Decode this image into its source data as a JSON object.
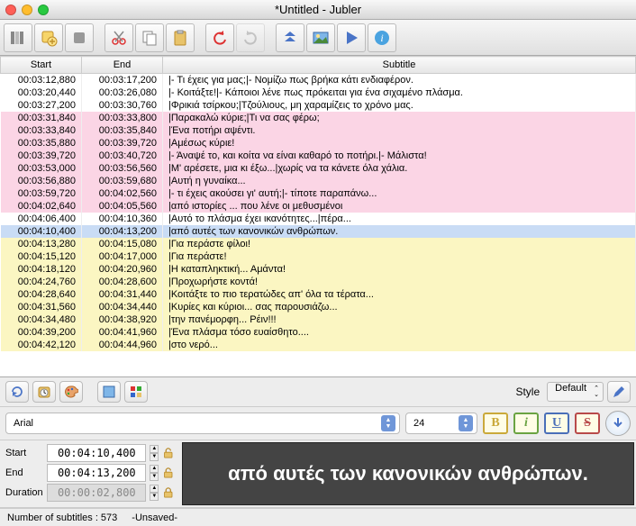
{
  "window": {
    "title": "*Untitled - Jubler"
  },
  "columns": {
    "start": "Start",
    "end": "End",
    "subtitle": "Subtitle"
  },
  "rows": [
    {
      "c": "white",
      "s": "00:03:12,880",
      "e": "00:03:17,200",
      "t": "|- Τι έχεις για μας;|- Νομίζω πως βρήκα κάτι ενδιαφέρον."
    },
    {
      "c": "white",
      "s": "00:03:20,440",
      "e": "00:03:26,080",
      "t": "|- Κοιτάξτε!|- Κάποιοι λένε πως πρόκειται για ένα σιχαμένο πλάσμα."
    },
    {
      "c": "white",
      "s": "00:03:27,200",
      "e": "00:03:30,760",
      "t": "|Φρικιά τσίρκου;|Τζούλιους, μη χαραμίζεις το χρόνο μας."
    },
    {
      "c": "pink",
      "s": "00:03:31,840",
      "e": "00:03:33,800",
      "t": "|Παρακαλώ κύριε;|Τι να σας φέρω;"
    },
    {
      "c": "pink",
      "s": "00:03:33,840",
      "e": "00:03:35,840",
      "t": "|Ένα ποτήρι αψέντι."
    },
    {
      "c": "pink",
      "s": "00:03:35,880",
      "e": "00:03:39,720",
      "t": "|Αμέσως κύριε!"
    },
    {
      "c": "pink",
      "s": "00:03:39,720",
      "e": "00:03:40,720",
      "t": "|- Άναψέ το, και κοίτα να είναι καθαρό το ποτήρι.|- Μάλιστα!"
    },
    {
      "c": "pink",
      "s": "00:03:53,000",
      "e": "00:03:56,560",
      "t": "|Μ' αρέσετε, μια κι έξω...|χωρίς να τα κάνετε όλα χάλια."
    },
    {
      "c": "pink",
      "s": "00:03:56,880",
      "e": "00:03:59,680",
      "t": "|Αυτή η γυναίκα..."
    },
    {
      "c": "pink",
      "s": "00:03:59,720",
      "e": "00:04:02,560",
      "t": "|- τι έχεις ακούσει γι' αυτή;|- τίποτε παραπάνω..."
    },
    {
      "c": "pink",
      "s": "00:04:02,640",
      "e": "00:04:05,560",
      "t": "|από ιστορίες ... που λένε οι μεθυσμένοι"
    },
    {
      "c": "white",
      "s": "00:04:06,400",
      "e": "00:04:10,360",
      "t": "|Αυτό το πλάσμα έχει ικανότητες...|πέρα..."
    },
    {
      "c": "blue",
      "s": "00:04:10,400",
      "e": "00:04:13,200",
      "t": "|από αυτές των κανονικών ανθρώπων."
    },
    {
      "c": "yellow",
      "s": "00:04:13,280",
      "e": "00:04:15,080",
      "t": "|Για περάστε φίλοι!"
    },
    {
      "c": "yellow",
      "s": "00:04:15,120",
      "e": "00:04:17,000",
      "t": "|Για περάστε!"
    },
    {
      "c": "yellow",
      "s": "00:04:18,120",
      "e": "00:04:20,960",
      "t": "|Η καταπληκτική... Αμάντα!"
    },
    {
      "c": "yellow",
      "s": "00:04:24,760",
      "e": "00:04:28,600",
      "t": "|Προχωρήστε κοντά!"
    },
    {
      "c": "yellow",
      "s": "00:04:28,640",
      "e": "00:04:31,440",
      "t": "|Κοιτάξτε το πιο τερατώδες απ' όλα τα τέρατα..."
    },
    {
      "c": "yellow",
      "s": "00:04:31,560",
      "e": "00:04:34,440",
      "t": "|Κυρίες και κύριοι... σας παρουσιάζω..."
    },
    {
      "c": "yellow",
      "s": "00:04:34,480",
      "e": "00:04:38,920",
      "t": "|την πανέμορφη... Ρέιν!!!"
    },
    {
      "c": "yellow",
      "s": "00:04:39,200",
      "e": "00:04:41,960",
      "t": "|Ένα πλάσμα τόσο ευαίσθητο...."
    },
    {
      "c": "yellow",
      "s": "00:04:42,120",
      "e": "00:04:44,960",
      "t": "|στο νερό..."
    }
  ],
  "style": {
    "label": "Style",
    "value": "Default"
  },
  "font": {
    "family": "Arial",
    "size": "24"
  },
  "time": {
    "startLabel": "Start",
    "start": "00:04:10,400",
    "endLabel": "End",
    "end": "00:04:13,200",
    "durationLabel": "Duration",
    "duration": "00:00:02,800"
  },
  "preview": "από αυτές των κανονικών ανθρώπων.",
  "status": {
    "count": "Number of subtitles : 573",
    "unsaved": "-Unsaved-"
  },
  "format": {
    "b": "B",
    "i": "i",
    "u": "U",
    "s": "S"
  }
}
